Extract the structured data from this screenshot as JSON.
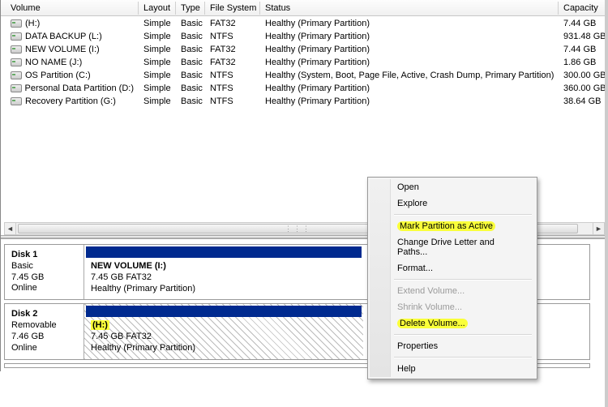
{
  "headers": {
    "volume": "Volume",
    "layout": "Layout",
    "type": "Type",
    "fs": "File System",
    "status": "Status",
    "capacity": "Capacity"
  },
  "rows": [
    {
      "volume": "(H:)",
      "layout": "Simple",
      "type": "Basic",
      "fs": "FAT32",
      "status": "Healthy (Primary Partition)",
      "capacity": "7.44 GB"
    },
    {
      "volume": "DATA BACKUP (L:)",
      "layout": "Simple",
      "type": "Basic",
      "fs": "NTFS",
      "status": "Healthy (Primary Partition)",
      "capacity": "931.48 GB"
    },
    {
      "volume": "NEW VOLUME (I:)",
      "layout": "Simple",
      "type": "Basic",
      "fs": "FAT32",
      "status": "Healthy (Primary Partition)",
      "capacity": "7.44 GB"
    },
    {
      "volume": "NO NAME (J:)",
      "layout": "Simple",
      "type": "Basic",
      "fs": "FAT32",
      "status": "Healthy (Primary Partition)",
      "capacity": "1.86 GB"
    },
    {
      "volume": "OS Partition (C:)",
      "layout": "Simple",
      "type": "Basic",
      "fs": "NTFS",
      "status": "Healthy (System, Boot, Page File, Active, Crash Dump, Primary Partition)",
      "capacity": "300.00 GB"
    },
    {
      "volume": "Personal Data Partition (D:)",
      "layout": "Simple",
      "type": "Basic",
      "fs": "NTFS",
      "status": "Healthy (Primary Partition)",
      "capacity": "360.00 GB"
    },
    {
      "volume": "Recovery Partition (G:)",
      "layout": "Simple",
      "type": "Basic",
      "fs": "NTFS",
      "status": "Healthy (Primary Partition)",
      "capacity": "38.64 GB"
    }
  ],
  "disks": {
    "d1": {
      "name": "Disk 1",
      "type": "Basic",
      "size": "7.45 GB",
      "state": "Online",
      "block_name": "NEW VOLUME (I:)",
      "block_info": "7.45 GB FAT32",
      "block_status": "Healthy (Primary Partition)"
    },
    "d2": {
      "name": "Disk 2",
      "type": "Removable",
      "size": "7.46 GB",
      "state": "Online",
      "block_name": "(H:)",
      "block_info": "7.45 GB FAT32",
      "block_status": "Healthy (Primary Partition)"
    }
  },
  "menu": {
    "open": "Open",
    "explore": "Explore",
    "mark_active": "Mark Partition as Active",
    "change_letter": "Change Drive Letter and Paths...",
    "format": "Format...",
    "extend": "Extend Volume...",
    "shrink": "Shrink Volume...",
    "delete": "Delete Volume...",
    "properties": "Properties",
    "help": "Help"
  }
}
